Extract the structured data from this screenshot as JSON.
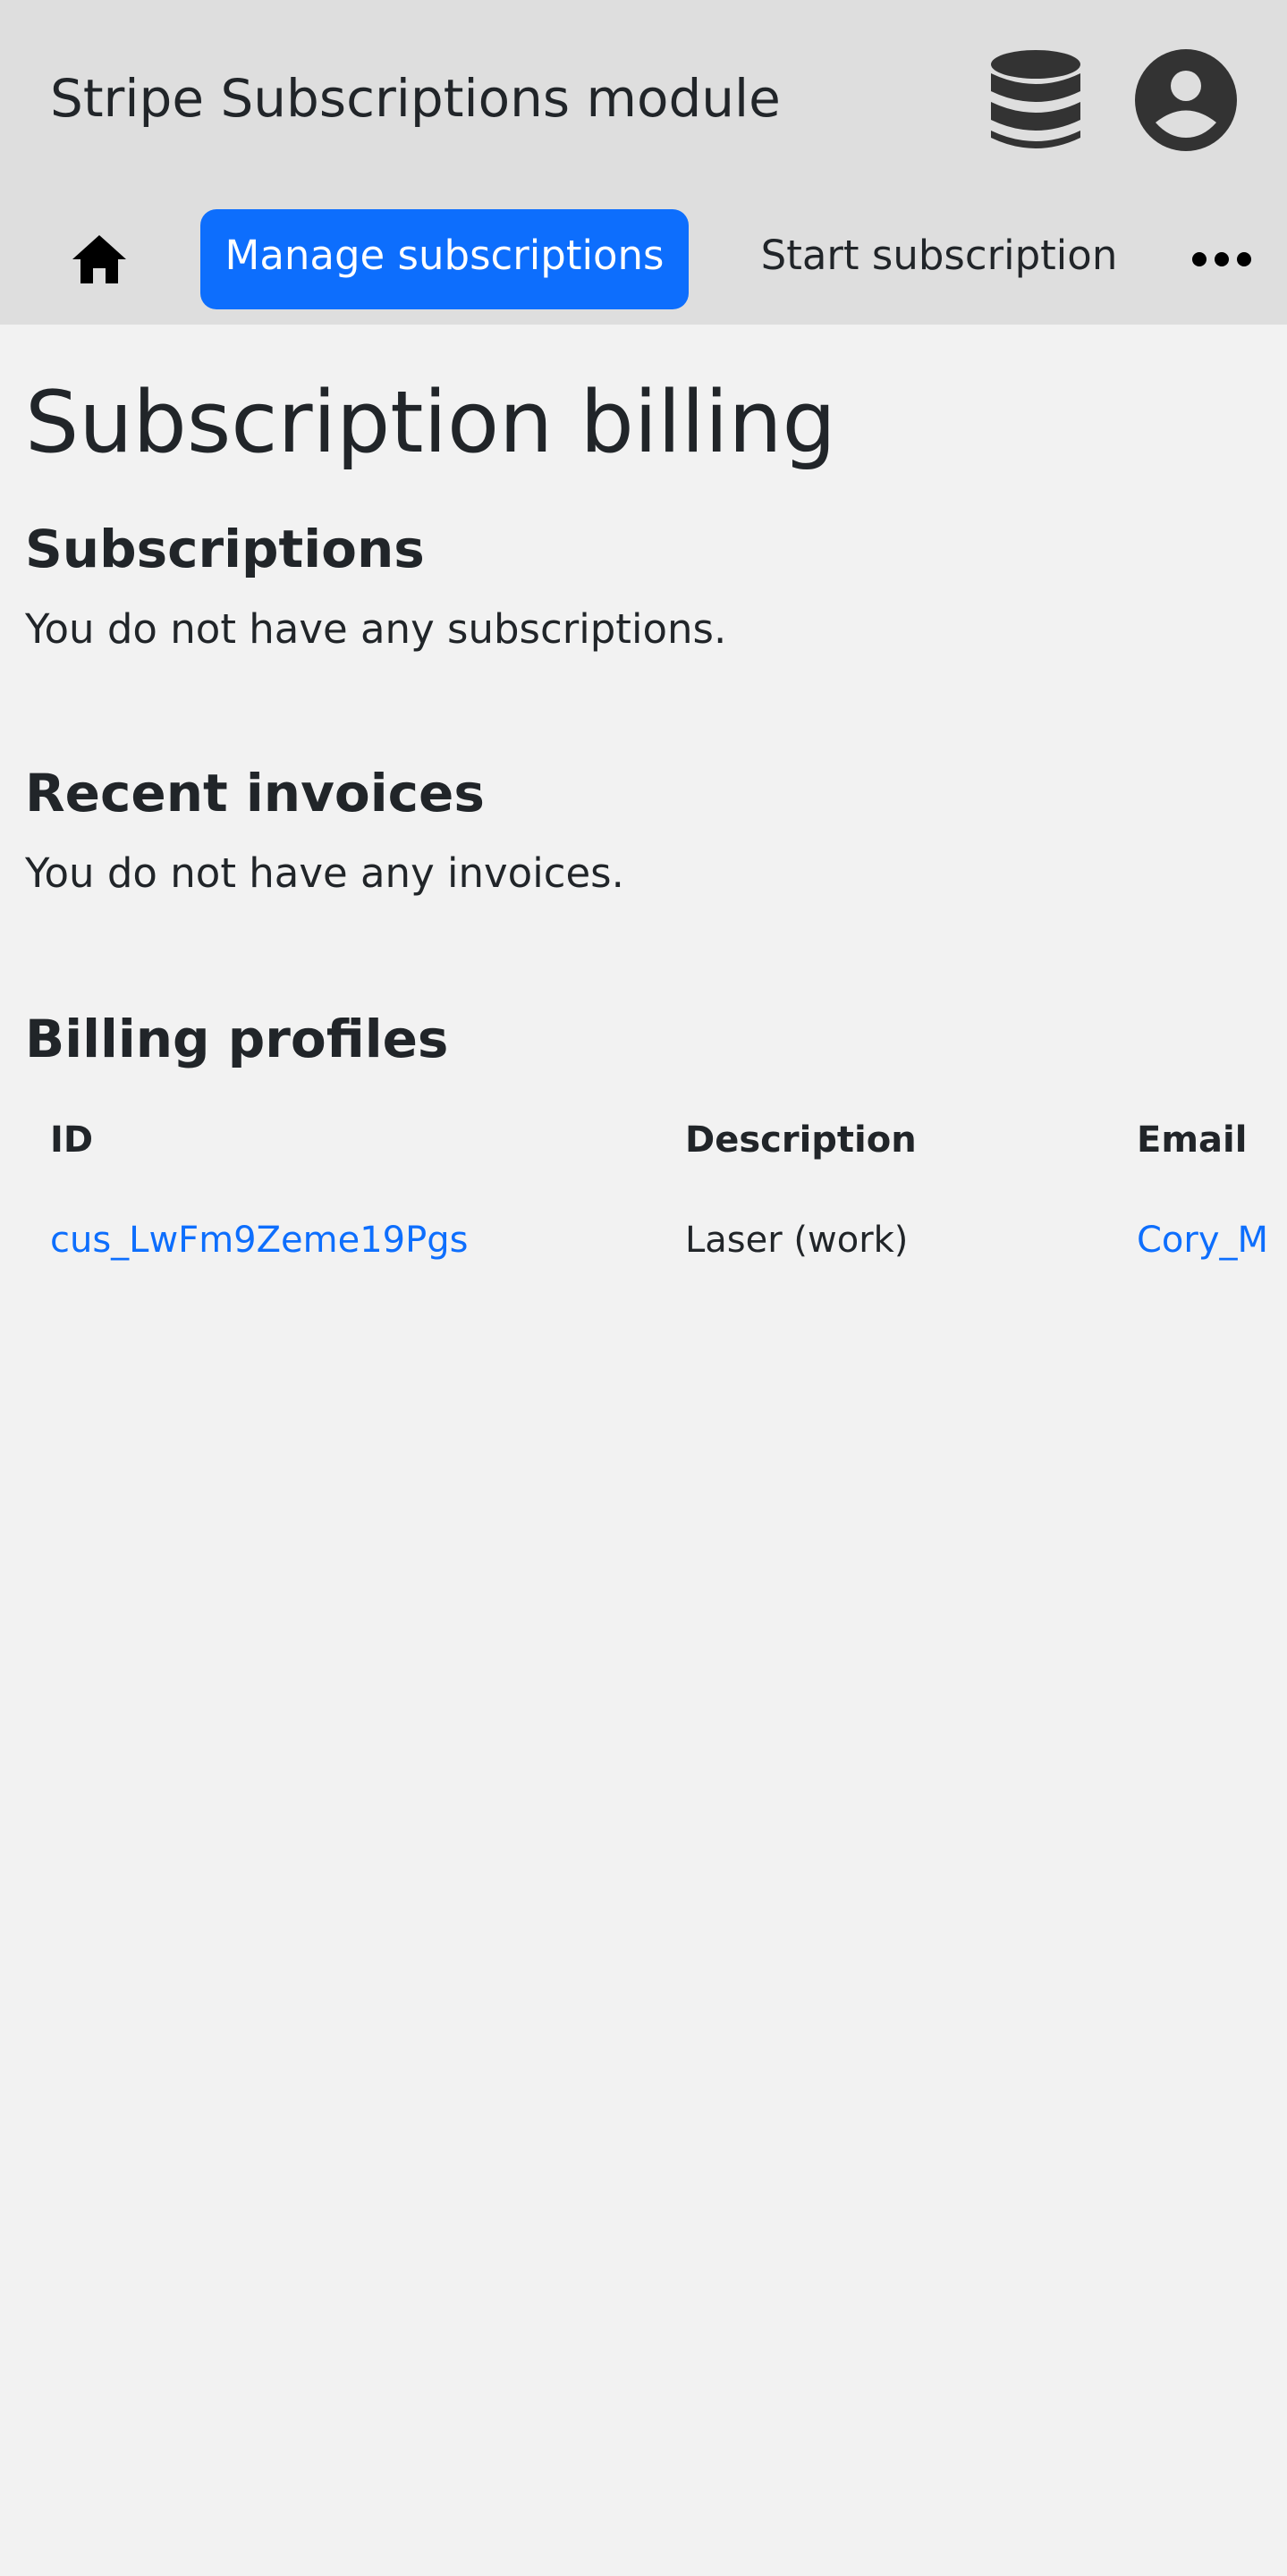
{
  "header": {
    "app_title": "Stripe Subscriptions module",
    "icons": {
      "database": "database-icon",
      "account": "user-circle-icon"
    }
  },
  "nav": {
    "home_icon": "home-icon",
    "tabs": [
      {
        "label": "Manage subscriptions",
        "active": true
      },
      {
        "label": "Start subscription",
        "active": false
      }
    ],
    "more_icon": "more-horizontal-icon"
  },
  "main": {
    "title": "Subscription billing",
    "subscriptions": {
      "heading": "Subscriptions",
      "empty_text": "You do not have any subscriptions."
    },
    "invoices": {
      "heading": "Recent invoices",
      "empty_text": "You do not have any invoices."
    },
    "billing_profiles": {
      "heading": "Billing profiles",
      "columns": [
        "ID",
        "Description",
        "Email"
      ],
      "rows": [
        {
          "id": "cus_LwFm9Zeme19Pgs",
          "description": "Laser (work)",
          "email": "Cory_M"
        }
      ]
    }
  },
  "colors": {
    "accent": "#0d6efd",
    "header_bg": "#dedede",
    "page_bg": "#f2f2f2",
    "text": "#212529",
    "icon": "#333333"
  }
}
